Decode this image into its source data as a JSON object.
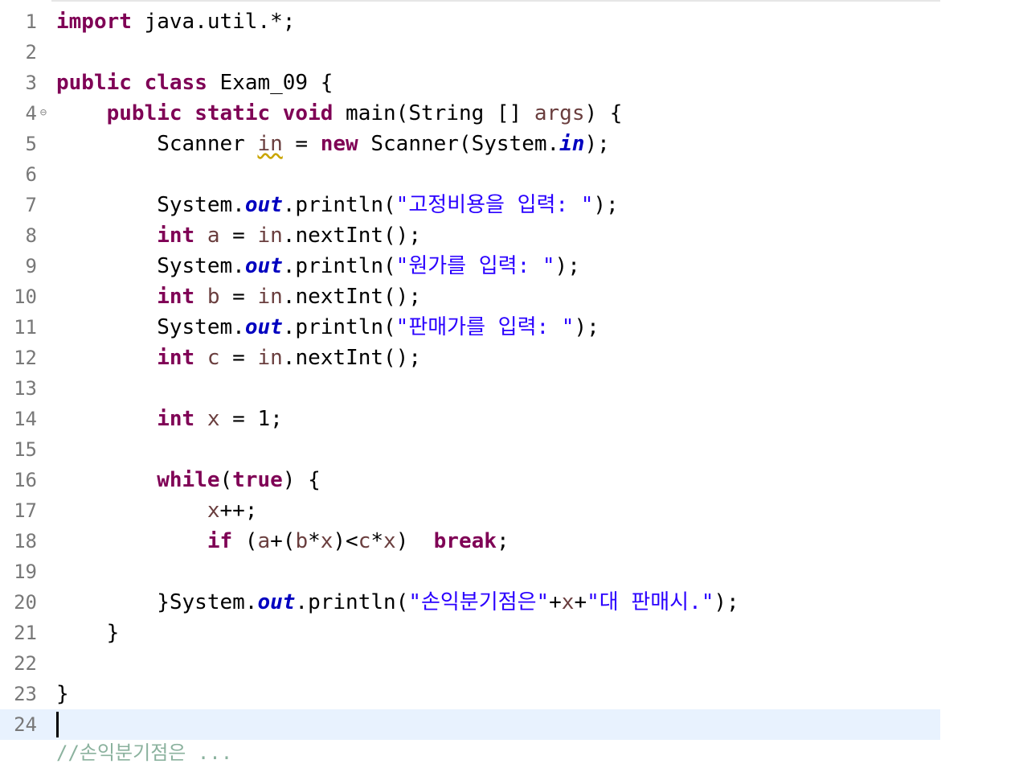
{
  "editor": {
    "lines": [
      {
        "num": "1",
        "code": "import java.util.*;"
      },
      {
        "num": "2",
        "code": ""
      },
      {
        "num": "3",
        "code": "public class Exam_09 {"
      },
      {
        "num": "4",
        "code": "    public static void main(String [] args) {"
      },
      {
        "num": "5",
        "code": "        Scanner in = new Scanner(System.in);"
      },
      {
        "num": "6",
        "code": ""
      },
      {
        "num": "7",
        "code": "        System.out.println(\"고정비용을 입력: \");"
      },
      {
        "num": "8",
        "code": "        int a = in.nextInt();"
      },
      {
        "num": "9",
        "code": "        System.out.println(\"원가를 입력: \");"
      },
      {
        "num": "10",
        "code": "        int b = in.nextInt();"
      },
      {
        "num": "11",
        "code": "        System.out.println(\"판매가를 입력: \");"
      },
      {
        "num": "12",
        "code": "        int c = in.nextInt();"
      },
      {
        "num": "13",
        "code": ""
      },
      {
        "num": "14",
        "code": "        int x = 1;"
      },
      {
        "num": "15",
        "code": ""
      },
      {
        "num": "16",
        "code": "        while(true) {"
      },
      {
        "num": "17",
        "code": "            x++;"
      },
      {
        "num": "18",
        "code": "            if (a+(b*x)<c*x)  break;"
      },
      {
        "num": "19",
        "code": ""
      },
      {
        "num": "20",
        "code": "        }System.out.println(\"손익분기점은\"+x+\"대 판매시.\");"
      },
      {
        "num": "21",
        "code": "    }"
      },
      {
        "num": "22",
        "code": ""
      },
      {
        "num": "23",
        "code": "}"
      },
      {
        "num": "24",
        "code": ""
      }
    ],
    "partial_line": "//손익분기점은 ...",
    "current_line": "24",
    "fold_icon_line": "4"
  },
  "colors": {
    "keyword": "#7f0055",
    "string": "#2a00ff",
    "static_field": "#0000c0",
    "local_var": "#6a3e3e",
    "line_number": "#787878",
    "current_line_bg": "#e8f2fe",
    "warning_underline": "#c9a500"
  },
  "icons": {
    "fold": "collapse-minus-icon"
  }
}
